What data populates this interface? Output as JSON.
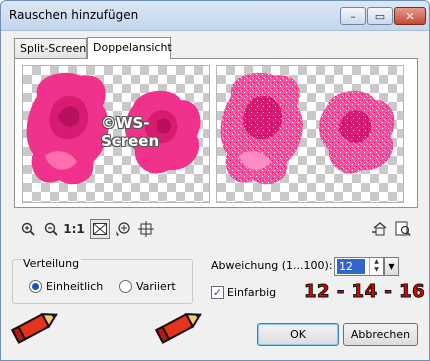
{
  "window": {
    "title": "Rauschen hinzufügen",
    "controls": {
      "minimize": "–",
      "maximize": "▭",
      "close": "✕"
    }
  },
  "tabs": [
    {
      "label": "Split-Screen",
      "active": false
    },
    {
      "label": "Doppelansicht",
      "active": true
    }
  ],
  "preview": {
    "watermark": "©WS-\nScreen",
    "left_image": "rose-original",
    "right_image": "rose-with-noise"
  },
  "toolbar": {
    "zoom_in_icon": "zoom-in-icon",
    "zoom_out_icon": "zoom-out-icon",
    "actual_size_label": "1:1",
    "fit_icon": "fit-window-icon",
    "navigate_icon": "navigate-icon",
    "pan_icon": "pan-icon",
    "reset_icon": "reset-icon",
    "preview_icon": "preview-icon"
  },
  "distribution": {
    "label": "Verteilung",
    "options": [
      {
        "label": "Einheitlich",
        "selected": true
      },
      {
        "label": "Variiert",
        "selected": false
      }
    ]
  },
  "deviation": {
    "label": "Abweichung (1...100):",
    "value": "12"
  },
  "monochrome": {
    "label": "Einfarbig",
    "checked": true
  },
  "annotation": "12 - 14 - 16",
  "buttons": {
    "ok": "OK",
    "cancel": "Abbrechen"
  },
  "colors": {
    "rose": "#f0328c",
    "rose_light": "#ff7ab8",
    "annotation": "#e30000",
    "pencil_body": "#e8321c",
    "pencil_tip": "#f2c879"
  }
}
